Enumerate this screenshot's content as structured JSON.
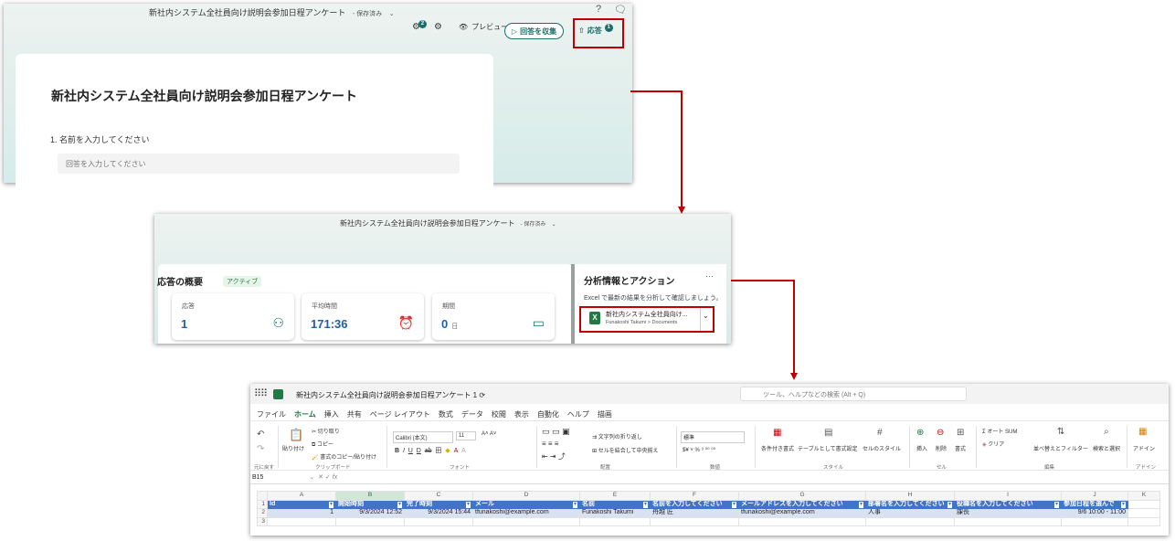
{
  "forms_editor": {
    "title": "新社内システム全社員向け説明会参加日程アンケート",
    "save_status": "- 保存済み",
    "help_glyph": "?",
    "feedback_glyph": "🗨",
    "toolbar": {
      "copilot_badge": "2",
      "preview_label": "プレビュー",
      "collect_label": "回答を収集",
      "responses_label": "応答",
      "responses_badge": "1"
    },
    "form_title": "新社内システム全社員向け説明会参加日程アンケート",
    "question_1": "1. 名前を入力してください",
    "answer_placeholder": "回答を入力してください"
  },
  "responses_view": {
    "title": "新社内システム全社員向け説明会参加日程アンケート",
    "save_status": "- 保存済み",
    "summary_title": "応答の概要",
    "summary_status": "アクティブ",
    "stats": [
      {
        "label": "応答",
        "value": "1",
        "unit": "",
        "icon": "people-icon"
      },
      {
        "label": "平均時間",
        "value": "171:36",
        "unit": "",
        "icon": "clock-icon"
      },
      {
        "label": "期間",
        "value": "0",
        "unit": "日",
        "icon": "calendar-icon"
      }
    ],
    "analysis_title": "分析情報とアクション",
    "analysis_more": "···",
    "analysis_desc": "Excel で最新の結果を分析して確認しましょう。",
    "file_name": "新社内システム全社員向け...",
    "file_path": "Funakoshi Takumi > Documents",
    "file_icon_letter": "X"
  },
  "excel": {
    "file_title": "新社内システム全社員向け説明会参加日程アンケート 1",
    "search_placeholder": "ツール、ヘルプなどの検索 (Alt + Q)",
    "tabs": [
      "ファイル",
      "ホーム",
      "挿入",
      "共有",
      "ページ レイアウト",
      "数式",
      "データ",
      "校閲",
      "表示",
      "自動化",
      "ヘルプ",
      "描画"
    ],
    "ribbon": {
      "undo_group": "元に戻す",
      "paste": "貼り付け",
      "cut": "切り取り",
      "copy": "コピー",
      "format_painter": "書式のコピー/貼り付け",
      "clipboard_group": "クリップボード",
      "font_name": "Calibri (本文)",
      "font_size": "11",
      "font_group": "フォント",
      "wrap_text": "文字列の折り返し",
      "merge_center": "セルを結合して中央揃え",
      "alignment_group": "配置",
      "number_format": "標準",
      "number_group": "数値",
      "conditional_format": "条件付き書式",
      "format_as_table": "テーブルとして書式設定",
      "cell_styles": "セルのスタイル",
      "styles_group": "スタイル",
      "insert": "挿入",
      "delete": "削除",
      "format": "書式",
      "cells_group": "セル",
      "autosum": "オート SUM",
      "clear": "クリア",
      "sort_filter": "並べ替えとフィルター",
      "find_select": "検索と選択",
      "editing_group": "編集",
      "addins": "アドイン",
      "addins_group": "アドイン"
    },
    "name_box": "B15",
    "columns": [
      "A",
      "B",
      "C",
      "D",
      "E",
      "F",
      "G",
      "H",
      "I",
      "J",
      "K"
    ],
    "headers": [
      "Id",
      "開始時刻",
      "完了時刻",
      "メール",
      "名前",
      "名前を入力してください",
      "メールアドレスを入力してください",
      "部署名を入力してください",
      "役職名を入力してください",
      "参加日程を選んで"
    ],
    "rows": [
      [
        "1",
        "9/3/2024 12:52",
        "9/3/2024 15:44",
        "tfunakoshi@example.com",
        "Funakoshi Takumi",
        "舟越 匠",
        "tfunakoshi@example.com",
        "人事",
        "課長",
        "9/6 10:00 - 11:00"
      ]
    ]
  }
}
